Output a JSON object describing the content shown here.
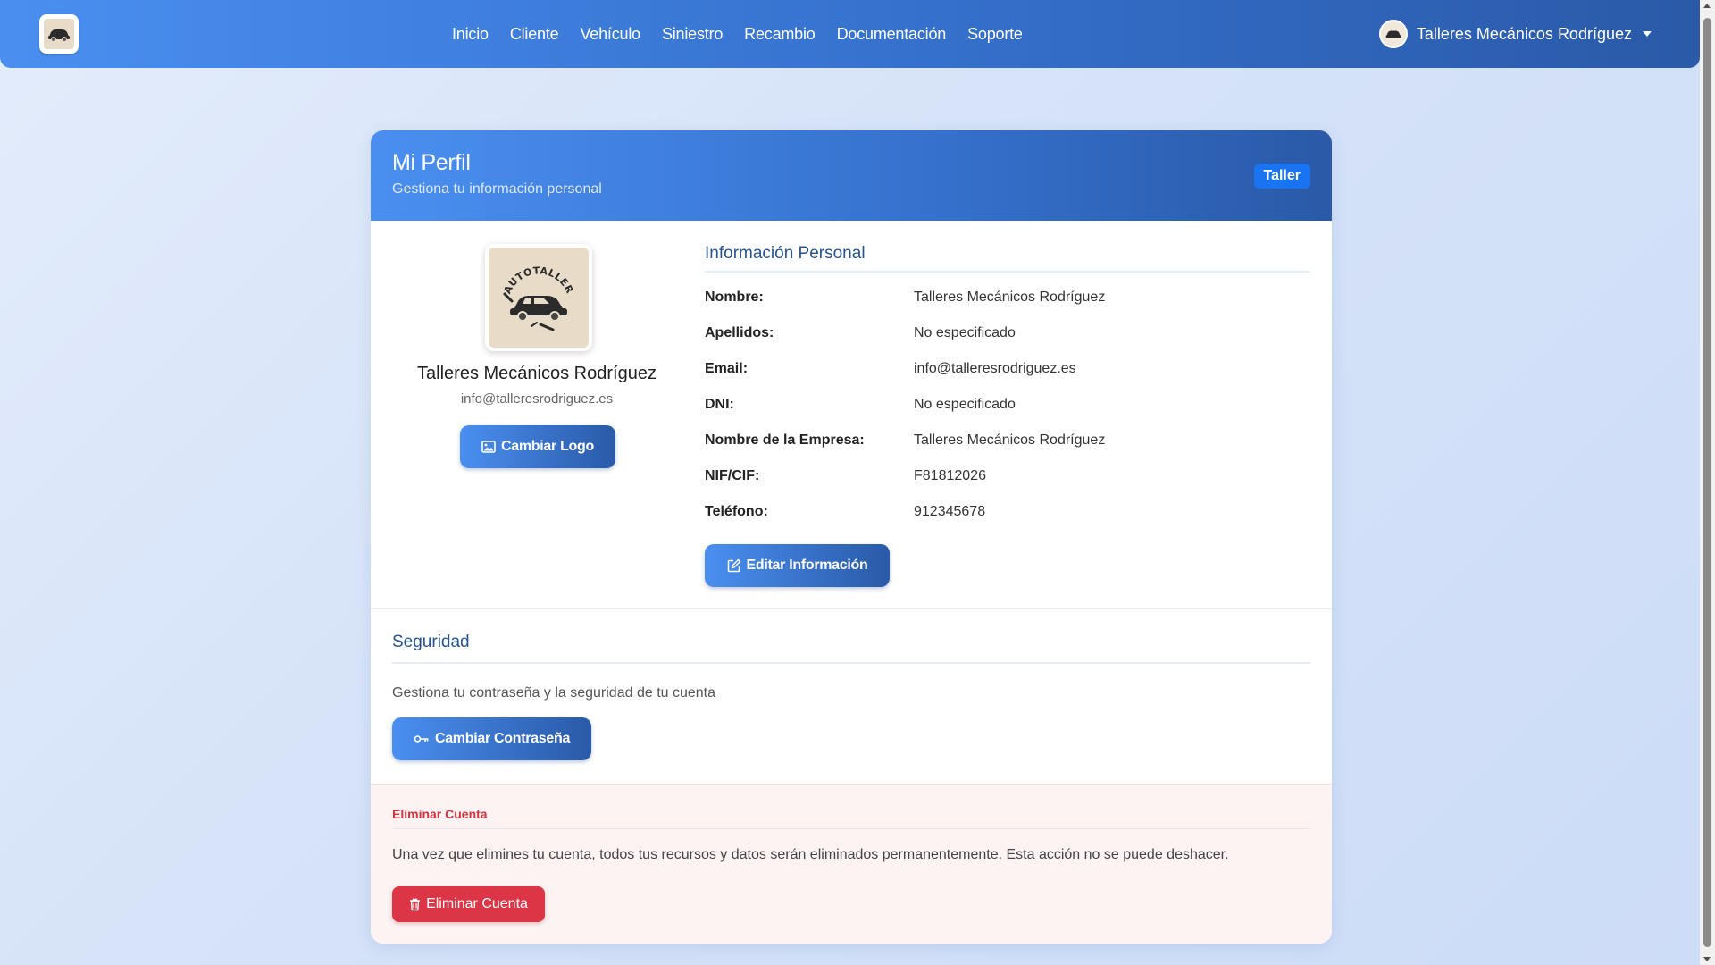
{
  "navbar": {
    "links": [
      "Inicio",
      "Cliente",
      "Vehículo",
      "Siniestro",
      "Recambio",
      "Documentación",
      "Soporte"
    ],
    "user_name": "Talleres Mecánicos Rodríguez",
    "brand_color": "#3570cc"
  },
  "header": {
    "title": "Mi Perfil",
    "subtitle": "Gestiona tu información personal",
    "badge": "Taller"
  },
  "profile": {
    "logo_text": "AUTOTALLER",
    "name": "Talleres Mecánicos Rodríguez",
    "email": "info@talleresrodriguez.es",
    "change_logo_label": "Cambiar Logo"
  },
  "personal_info": {
    "title": "Información Personal",
    "rows": [
      {
        "label": "Nombre:",
        "value": "Talleres Mecánicos Rodríguez"
      },
      {
        "label": "Apellidos:",
        "value": "No especificado"
      },
      {
        "label": "Email:",
        "value": "info@talleresrodriguez.es"
      },
      {
        "label": "DNI:",
        "value": "No especificado"
      },
      {
        "label": "Nombre de la Empresa:",
        "value": "Talleres Mecánicos Rodríguez"
      },
      {
        "label": "NIF/CIF:",
        "value": "F81812026"
      },
      {
        "label": "Teléfono:",
        "value": "912345678"
      }
    ],
    "edit_label": "Editar Información"
  },
  "security": {
    "title": "Seguridad",
    "description": "Gestiona tu contraseña y la seguridad de tu cuenta",
    "change_password_label": "Cambiar Contraseña"
  },
  "delete_account": {
    "title": "Eliminar Cuenta",
    "description": "Una vez que elimines tu cuenta, todos tus recursos y datos serán eliminados permanentemente. Esta acción no se puede deshacer.",
    "button_label": "Eliminar Cuenta",
    "danger_color": "#dc3545"
  }
}
